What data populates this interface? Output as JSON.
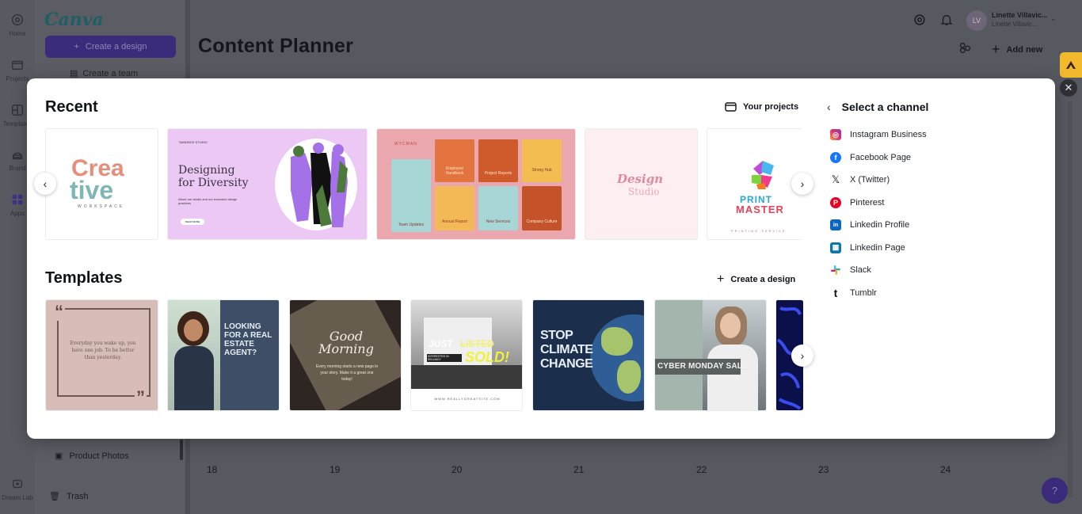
{
  "app": {
    "brand": "Canva",
    "brand_color": "#1d5f63",
    "accent": "#3c2a7b"
  },
  "rail": {
    "items": [
      {
        "label": "Home",
        "icon": "home-icon"
      },
      {
        "label": "Projects",
        "icon": "folder-icon"
      },
      {
        "label": "Templates",
        "icon": "templates-icon"
      },
      {
        "label": "Brand",
        "icon": "brand-icon"
      },
      {
        "label": "Apps",
        "icon": "apps-icon"
      },
      {
        "label": "Dream Lab",
        "icon": "dream-lab-icon"
      }
    ]
  },
  "sidebar": {
    "create_design_label": "Create a design",
    "create_team_label": "Create a team",
    "links": [
      {
        "label": "Product Photos",
        "icon": "folder-photo-icon"
      },
      {
        "label": "Trash",
        "icon": "trash-icon"
      }
    ]
  },
  "header": {
    "page_title": "Content Planner",
    "user_name": "Linette Villavic...",
    "user_sub": "Linette Villavic...",
    "avatar_initials": "LV",
    "add_new_label": "Add new"
  },
  "calendar": {
    "days": [
      "18",
      "19",
      "20",
      "21",
      "22",
      "23",
      "24"
    ]
  },
  "help": {
    "label": "?"
  },
  "modal": {
    "recent": {
      "title": "Recent",
      "action_label": "Your projects",
      "items": [
        {
          "name": "Creative Workspace logo",
          "line1": "Crea",
          "line2": "tive",
          "sub": "WORKSPACE"
        },
        {
          "name": "Designing for Diversity",
          "kicker": "SANDBOX STUDIO",
          "headline1": "Designing",
          "headline2": "for Diversity",
          "body": "About our studio and our exclusive design practices",
          "cta": "READ MORE"
        },
        {
          "name": "Company highlights grid",
          "brand": "WYCMAN",
          "tiles": [
            "Team Updates",
            "Employee Handbook",
            "Project Reports",
            "Strong Hub",
            "Annual Report",
            "New Services",
            "Company Culture"
          ]
        },
        {
          "name": "Design Studio logo",
          "line1": "Design",
          "line2": "Studio"
        },
        {
          "name": "Print Master logo",
          "line1": "PRINT",
          "line2": "MASTER",
          "sub": "PRINTING SERVICE"
        }
      ]
    },
    "templates": {
      "title": "Templates",
      "action_label": "Create a design",
      "items": [
        {
          "name": "Quote post",
          "quote": "Everyday you wake up, you have one job. To be better than yesterday."
        },
        {
          "name": "Real estate agent",
          "headline": "LOOKING FOR A REAL ESTATE AGENT?"
        },
        {
          "name": "Good morning",
          "headline1": "Good",
          "headline2": "Morning",
          "body": "Every morning starts a new page in your story. Make it a great one today!"
        },
        {
          "name": "Just listed / sold",
          "headline1": "JUST",
          "headline2": "LISTED",
          "stamp": "SOLD!",
          "tag": "INTERESTED IN SELLING?",
          "url": "WWW.REALLYGREATSITE.COM"
        },
        {
          "name": "Stop climate change",
          "headline": "STOP CLIMATE CHANGE"
        },
        {
          "name": "Cyber Monday sale",
          "headline": "CYBER MONDAY SALE"
        },
        {
          "name": "Blue confetti",
          "headline": ""
        }
      ]
    },
    "channels": {
      "title": "Select a channel",
      "items": [
        {
          "label": "Instagram Business",
          "icon": "instagram-icon",
          "color": "#e1306c"
        },
        {
          "label": "Facebook Page",
          "icon": "facebook-icon",
          "color": "#1877f2"
        },
        {
          "label": "X (Twitter)",
          "icon": "x-twitter-icon",
          "color": "#111111"
        },
        {
          "label": "Pinterest",
          "icon": "pinterest-icon",
          "color": "#e60023"
        },
        {
          "label": "Linkedin Profile",
          "icon": "linkedin-icon",
          "color": "#0a66c2"
        },
        {
          "label": "Linkedin Page",
          "icon": "linkedin-page-icon",
          "color": "#0e76a8"
        },
        {
          "label": "Slack",
          "icon": "slack-icon",
          "color": "#4a154b"
        },
        {
          "label": "Tumblr",
          "icon": "tumblr-icon",
          "color": "#001935"
        }
      ]
    }
  }
}
